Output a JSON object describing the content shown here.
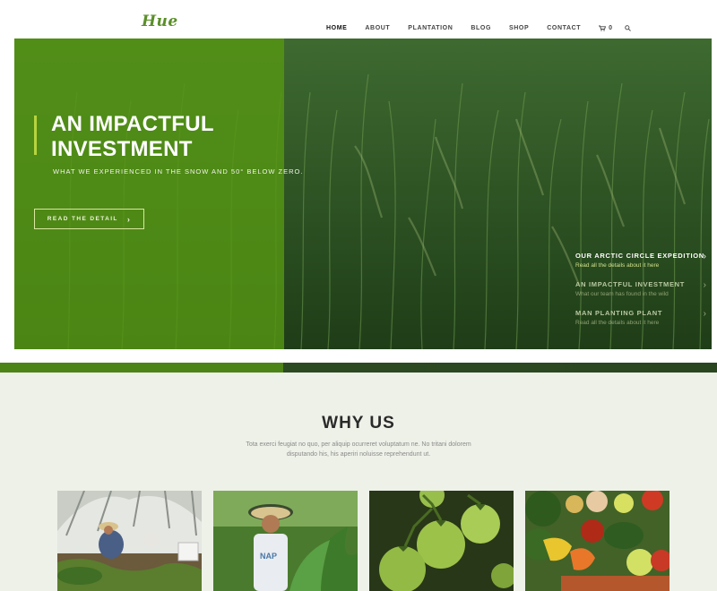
{
  "brand": {
    "logo": "Hue",
    "accent": "#5b8f2a"
  },
  "nav": {
    "items": [
      "HOME",
      "ABOUT",
      "PLANTATION",
      "BLOG",
      "SHOP",
      "CONTACT"
    ],
    "active": "HOME",
    "cart_count": "0"
  },
  "hero": {
    "title": "AN IMPACTFUL INVESTMENT",
    "subtitle": "WHAT WE EXPERIENCED IN THE SNOW AND 50° BELOW ZERO.",
    "button_label": "READ THE DETAIL",
    "slides": [
      {
        "title": "OUR ARCTIC CIRCLE EXPEDITION",
        "desc": "Read all the details about it here"
      },
      {
        "title": "AN IMPACTFUL INVESTMENT",
        "desc": "What our team has found in the wild"
      },
      {
        "title": "MAN PLANTING PLANT",
        "desc": "Read all the details about it here"
      }
    ]
  },
  "why": {
    "title": "WHY US",
    "text": "Tota exerci feugiat no quo, per aliquip ocurreret voluptatum ne. No tritani dolorem disputando his, his aperiri noluisse reprehendunt ut."
  },
  "cards": [
    {
      "image": "greenhouse-farmers-photo"
    },
    {
      "image": "farmer-with-leaves-photo"
    },
    {
      "image": "green-tomatoes-photo"
    },
    {
      "image": "vegetables-photo"
    }
  ]
}
